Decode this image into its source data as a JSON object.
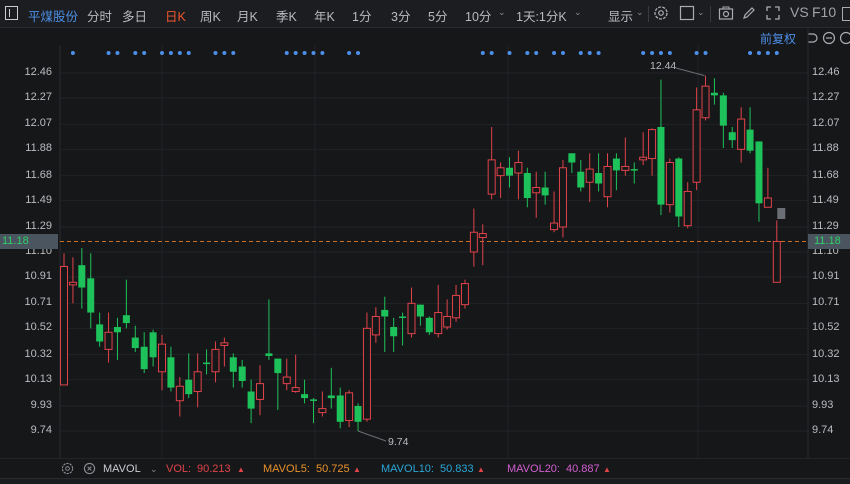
{
  "toolbar": {
    "stock_name": "平煤股份",
    "tabs": [
      "分时",
      "多日",
      "日K",
      "周K",
      "月K",
      "季K",
      "年K",
      "1分",
      "3分",
      "5分",
      "10分"
    ],
    "active_tab": "日K",
    "period_select": "1天:1分K",
    "display_label": "显示",
    "vs_label": "VS",
    "f10_label": "F10"
  },
  "subbar": {
    "adjust_label": "前复权"
  },
  "axis": {
    "ticks": [
      "12.46",
      "12.27",
      "12.07",
      "11.88",
      "11.68",
      "11.49",
      "11.29",
      "11.10",
      "10.91",
      "10.71",
      "10.52",
      "10.32",
      "10.13",
      "9.93",
      "9.74"
    ],
    "tick_values": [
      12.46,
      12.27,
      12.07,
      11.88,
      11.68,
      11.49,
      11.29,
      11.1,
      10.91,
      10.71,
      10.52,
      10.32,
      10.13,
      9.93,
      9.74
    ],
    "current_price": "11.18",
    "current_value": 11.18
  },
  "chart_data": {
    "type": "candlestick",
    "ylim": [
      9.74,
      12.46
    ],
    "high_label": "12.44",
    "low_label": "9.74",
    "colors": {
      "up": "#e0434a",
      "down": "#1ec25a",
      "price_line": "#c8702a",
      "marker": "#4d8fe8"
    },
    "ohlc": [
      [
        10.09,
        11.09,
        10.09,
        10.99
      ],
      [
        10.85,
        11.06,
        10.71,
        10.87
      ],
      [
        11.0,
        11.13,
        10.67,
        10.83
      ],
      [
        10.9,
        11.09,
        10.52,
        10.64
      ],
      [
        10.55,
        10.64,
        10.38,
        10.42
      ],
      [
        10.36,
        10.64,
        10.26,
        10.49
      ],
      [
        10.53,
        10.6,
        10.28,
        10.49
      ],
      [
        10.62,
        10.89,
        10.52,
        10.56
      ],
      [
        10.45,
        10.54,
        10.34,
        10.37
      ],
      [
        10.38,
        10.49,
        10.18,
        10.21
      ],
      [
        10.49,
        10.51,
        10.23,
        10.3
      ],
      [
        10.19,
        10.47,
        10.05,
        10.4
      ],
      [
        10.3,
        10.38,
        10.04,
        10.07
      ],
      [
        9.97,
        10.15,
        9.85,
        10.08
      ],
      [
        10.13,
        10.33,
        9.99,
        10.02
      ],
      [
        10.04,
        10.33,
        9.92,
        10.19
      ],
      [
        10.26,
        10.36,
        10.17,
        10.25
      ],
      [
        10.19,
        10.42,
        10.11,
        10.36
      ],
      [
        10.39,
        10.45,
        10.23,
        10.41
      ],
      [
        10.3,
        10.33,
        10.07,
        10.19
      ],
      [
        10.23,
        10.28,
        10.07,
        10.12
      ],
      [
        10.04,
        10.13,
        9.8,
        9.91
      ],
      [
        9.98,
        10.24,
        9.86,
        10.1
      ],
      [
        10.33,
        10.74,
        10.28,
        10.31
      ],
      [
        10.29,
        10.29,
        9.9,
        10.18
      ],
      [
        10.1,
        10.29,
        10.05,
        10.15
      ],
      [
        10.04,
        10.32,
        10.03,
        10.07
      ],
      [
        10.02,
        10.13,
        9.95,
        9.99
      ],
      [
        9.98,
        9.99,
        9.8,
        9.97
      ],
      [
        9.88,
        10.04,
        9.85,
        9.91
      ],
      [
        10.01,
        10.22,
        9.91,
        9.99
      ],
      [
        10.01,
        10.07,
        9.76,
        9.81
      ],
      [
        9.82,
        10.05,
        9.77,
        10.03
      ],
      [
        9.93,
        9.95,
        9.74,
        9.81
      ],
      [
        9.83,
        10.64,
        9.81,
        10.52
      ],
      [
        10.47,
        10.68,
        10.41,
        10.61
      ],
      [
        10.66,
        10.76,
        10.34,
        10.61
      ],
      [
        10.53,
        10.6,
        10.34,
        10.46
      ],
      [
        10.61,
        10.64,
        10.39,
        10.6
      ],
      [
        10.48,
        10.83,
        10.45,
        10.71
      ],
      [
        10.7,
        10.7,
        10.54,
        10.61
      ],
      [
        10.6,
        10.61,
        10.47,
        10.49
      ],
      [
        10.48,
        10.85,
        10.45,
        10.64
      ],
      [
        10.53,
        10.74,
        10.51,
        10.61
      ],
      [
        10.6,
        10.85,
        10.57,
        10.77
      ],
      [
        10.7,
        10.89,
        10.67,
        10.86
      ],
      [
        11.1,
        11.43,
        10.99,
        11.25
      ],
      [
        11.21,
        11.31,
        11.0,
        11.24
      ],
      [
        11.54,
        12.05,
        11.5,
        11.8
      ],
      [
        11.68,
        11.78,
        11.51,
        11.74
      ],
      [
        11.74,
        11.82,
        11.59,
        11.68
      ],
      [
        11.7,
        11.87,
        11.5,
        11.78
      ],
      [
        11.7,
        11.74,
        11.44,
        11.51
      ],
      [
        11.55,
        11.71,
        11.36,
        11.59
      ],
      [
        11.59,
        11.71,
        11.46,
        11.53
      ],
      [
        11.27,
        11.56,
        11.25,
        11.32
      ],
      [
        11.29,
        11.8,
        11.21,
        11.74
      ],
      [
        11.85,
        11.85,
        11.7,
        11.78
      ],
      [
        11.71,
        11.8,
        11.56,
        11.59
      ],
      [
        11.63,
        11.85,
        11.48,
        11.73
      ],
      [
        11.7,
        11.85,
        11.56,
        11.62
      ],
      [
        11.52,
        11.85,
        11.44,
        11.75
      ],
      [
        11.81,
        11.85,
        11.57,
        11.72
      ],
      [
        11.72,
        11.97,
        11.68,
        11.75
      ],
      [
        11.73,
        11.78,
        11.62,
        11.72
      ],
      [
        11.8,
        12.01,
        11.76,
        11.82
      ],
      [
        11.81,
        12.04,
        11.68,
        12.03
      ],
      [
        12.05,
        12.41,
        11.38,
        11.46
      ],
      [
        11.46,
        11.81,
        11.4,
        11.78
      ],
      [
        11.81,
        11.82,
        11.29,
        11.37
      ],
      [
        11.3,
        11.63,
        11.28,
        11.56
      ],
      [
        11.63,
        12.35,
        11.57,
        12.18
      ],
      [
        12.12,
        12.44,
        12.1,
        12.36
      ],
      [
        12.31,
        12.42,
        12.22,
        12.29
      ],
      [
        12.29,
        12.31,
        11.89,
        12.06
      ],
      [
        12.01,
        12.05,
        11.89,
        11.95
      ],
      [
        11.88,
        12.2,
        11.78,
        12.11
      ],
      [
        12.03,
        12.2,
        11.85,
        11.87
      ],
      [
        11.94,
        11.94,
        11.33,
        11.47
      ],
      [
        11.44,
        11.74,
        11.44,
        11.51
      ],
      [
        10.87,
        11.34,
        10.87,
        11.18
      ]
    ],
    "event_marker_indices": [
      1,
      5,
      6,
      8,
      9,
      11,
      12,
      13,
      14,
      17,
      18,
      19,
      25,
      26,
      27,
      28,
      29,
      32,
      33,
      47,
      48,
      50,
      52,
      53,
      55,
      56,
      58,
      59,
      60,
      65,
      66,
      67,
      68,
      71,
      72,
      77,
      78,
      79,
      80
    ]
  },
  "indicator_bar": {
    "indicator_select": "MAVOL",
    "items": [
      {
        "label": "VOL:",
        "value": "90.213",
        "color": "#e0434a"
      },
      {
        "label": "MAVOL5:",
        "value": "50.725",
        "color": "#e8912c"
      },
      {
        "label": "MAVOL10:",
        "value": "50.833",
        "color": "#2aa7d8"
      },
      {
        "label": "MAVOL20:",
        "value": "40.887",
        "color": "#d35fd0"
      }
    ],
    "trend_arrow": "▲"
  }
}
